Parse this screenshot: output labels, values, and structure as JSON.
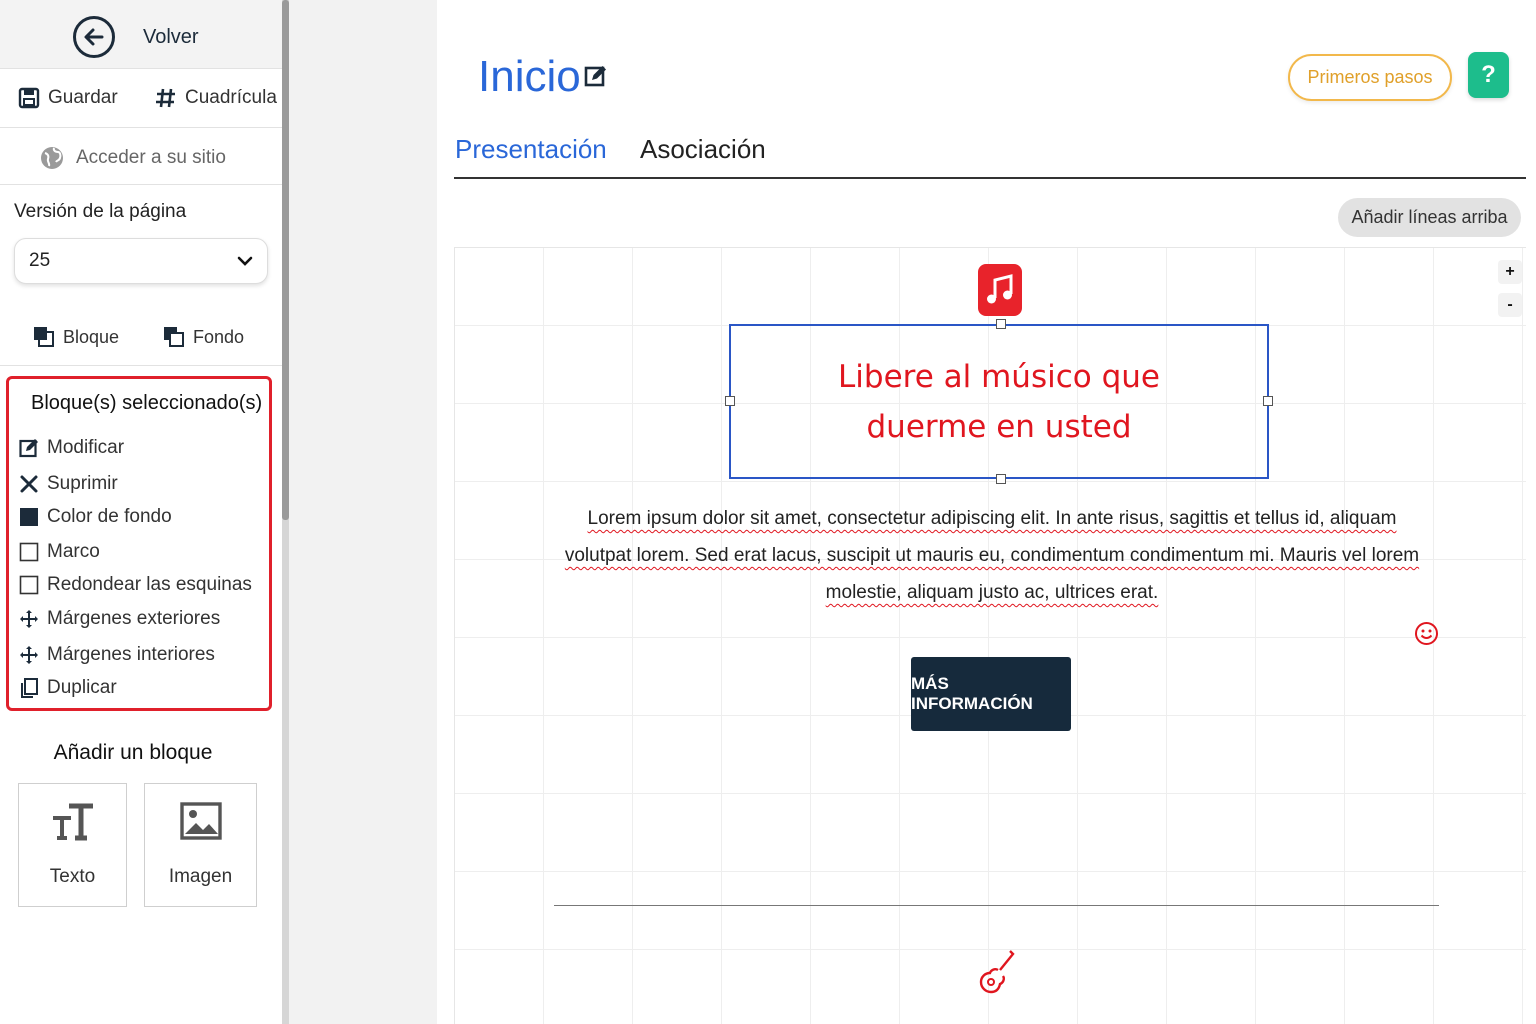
{
  "sidebar": {
    "back_label": "Volver",
    "save_label": "Guardar",
    "grid_label": "Cuadrícula",
    "site_label": "Acceder a su sitio",
    "version_label": "Versión de la página",
    "version_value": "25",
    "block_label": "Bloque",
    "background_label": "Fondo",
    "selected_title": "Bloque(s) seleccionado(s)",
    "actions": [
      {
        "label": "Modificar",
        "icon": "edit-icon"
      },
      {
        "label": "Suprimir",
        "icon": "x-icon"
      },
      {
        "label": "Color de fondo",
        "icon": "filled-square-icon"
      },
      {
        "label": "Marco",
        "icon": "checkbox-icon"
      },
      {
        "label": "Redondear las esquinas",
        "icon": "checkbox-icon"
      },
      {
        "label": "Márgenes exteriores",
        "icon": "move-icon"
      },
      {
        "label": "Márgenes interiores",
        "icon": "move-icon"
      },
      {
        "label": "Duplicar",
        "icon": "copy-icon"
      }
    ],
    "add_block_title": "Añadir un bloque",
    "add_blocks": [
      {
        "label": "Texto",
        "icon": "text-icon"
      },
      {
        "label": "Imagen",
        "icon": "image-icon"
      }
    ]
  },
  "header": {
    "title": "Inicio",
    "first_steps": "Primeros pasos",
    "help": "?"
  },
  "tabs": [
    {
      "label": "Presentación",
      "active": true
    },
    {
      "label": "Asociación",
      "active": false
    }
  ],
  "canvas": {
    "add_lines_label": "Añadir líneas arriba",
    "zoom_in": "+",
    "zoom_out": "-",
    "headline": "Libere al músico que duerme en usted",
    "body": "Lorem ipsum dolor sit amet, consectetur adipiscing elit. In ante risus, sagittis et tellus id, aliquam volutpat lorem. Sed erat lacus, suscipit ut mauris eu, condimentum condimentum mi. Mauris vel lorem molestie, aliquam justo ac, ultrices erat.",
    "button_label": "MÁS INFORMACIÓN"
  },
  "colors": {
    "accent_blue": "#2a67d8",
    "headline_red": "#e0161f",
    "help_green": "#1dbd8c",
    "first_steps_orange": "#f2b84b",
    "button_dark": "#162a3c",
    "selection_border": "#e0202b"
  }
}
